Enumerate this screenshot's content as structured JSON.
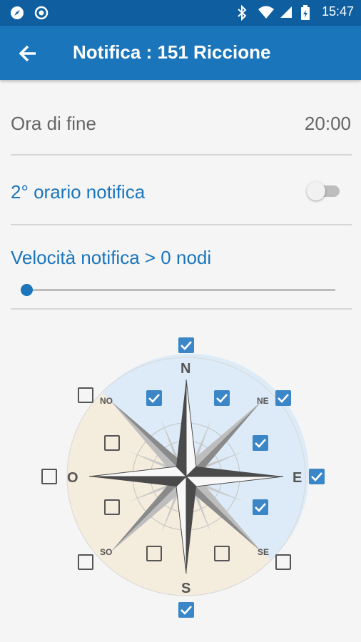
{
  "status_bar": {
    "time": "15:47",
    "left_icons": [
      "compass-icon",
      "target-icon"
    ],
    "right_icons": [
      "bluetooth-icon",
      "wifi-icon",
      "signal-icon",
      "battery-icon"
    ]
  },
  "app_bar": {
    "title": "Notifica : 151 Riccione",
    "back_icon": "arrow-left-icon",
    "color": "#1b75bb"
  },
  "settings": {
    "end_time_label": "Ora di fine",
    "end_time_value": "20:00",
    "second_schedule_label": "2° orario notifica",
    "second_schedule_enabled": false,
    "speed_label": "Velocità notifica > 0 nodi",
    "speed_value": 0
  },
  "compass": {
    "labels": {
      "N": "N",
      "S": "S",
      "E": "E",
      "O": "O",
      "NO": "NO",
      "NE": "NE",
      "SO": "SO",
      "SE": "SE"
    },
    "checkboxes": {
      "n": true,
      "s": true,
      "e": true,
      "o": false,
      "no": false,
      "ne": true,
      "so": false,
      "se": false,
      "inner_n_left": true,
      "inner_n_right": true,
      "inner_ne_upper": true,
      "inner_ne_lower": true,
      "inner_no_upper": false,
      "inner_no_lower": false,
      "inner_s_left": false,
      "inner_s_right": false
    },
    "selected_color": "#3b86c7",
    "west_sector_color": "#f4ecdc",
    "east_sector_color": "#dcebf7"
  }
}
